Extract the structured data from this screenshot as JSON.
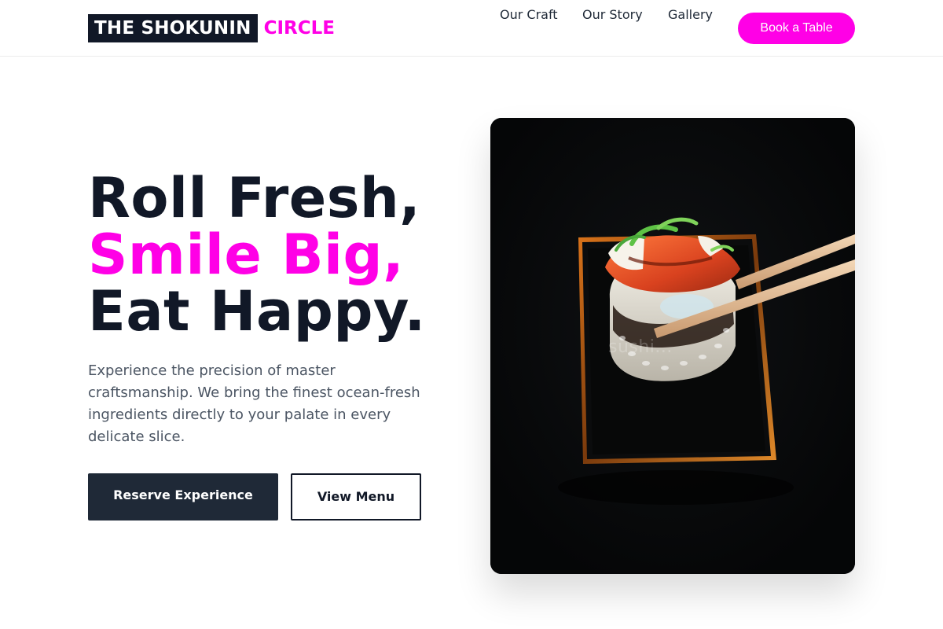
{
  "brand": {
    "name_primary": "THE SHOKUNIN",
    "name_accent": "CIRCLE",
    "accent_color": "#ff00e6",
    "dark_color": "#111827"
  },
  "nav": {
    "links": [
      "Our Craft",
      "Our Story",
      "Gallery"
    ],
    "cta_label": "Book a Table"
  },
  "hero": {
    "headline_line_1": "Roll Fresh,",
    "headline_line_2": "Smile Big,",
    "headline_line_3": "Eat Happy.",
    "description": "Experience the precision of master craftsmanship. We bring the finest ocean-fresh ingredients directly to your palate in every delicate slice.",
    "primary_button": "Reserve Experience",
    "secondary_button": "View Menu",
    "image_watermark": "sushi..."
  },
  "icons": {
    "hero_image": "sushi-roll-with-chopsticks-image"
  }
}
